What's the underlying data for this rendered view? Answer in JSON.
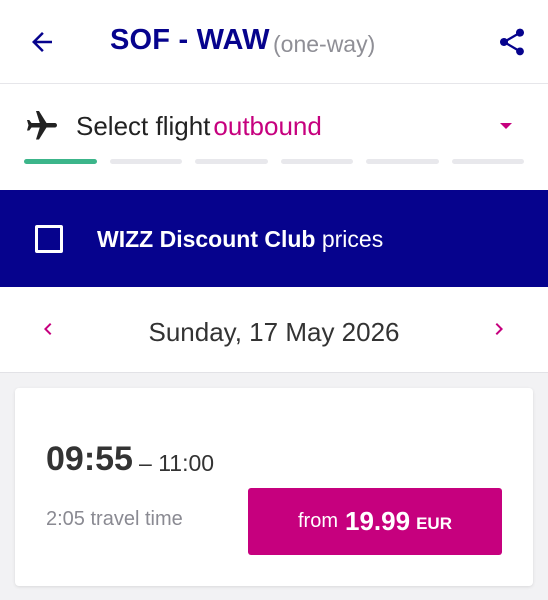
{
  "header": {
    "route": "SOF - WAW",
    "trip_type": "(one-way)"
  },
  "stepper": {
    "label_prefix": "Select flight",
    "label_accent": "outbound",
    "steps": [
      {
        "active": true
      },
      {
        "active": false
      },
      {
        "active": false
      },
      {
        "active": false
      },
      {
        "active": false
      },
      {
        "active": false
      }
    ]
  },
  "discount": {
    "label_bold": "WIZZ Discount Club",
    "label_rest": "prices",
    "checked": false
  },
  "date": {
    "label": "Sunday, 17 May 2026"
  },
  "flight": {
    "departure": "09:55",
    "separator": "–",
    "arrival": "11:00",
    "travel_time": "2:05 travel time",
    "price_prefix": "from",
    "price": "19.99",
    "currency": "EUR"
  },
  "colors": {
    "brand_navy": "#06038d",
    "brand_magenta": "#c6007e",
    "progress_active": "#3cb58a"
  },
  "icons": {
    "back": "arrow-left-icon",
    "share": "share-icon",
    "plane": "airplane-icon",
    "dropdown": "caret-down-icon",
    "prev_date": "chevron-left-icon",
    "next_date": "chevron-right-icon"
  }
}
